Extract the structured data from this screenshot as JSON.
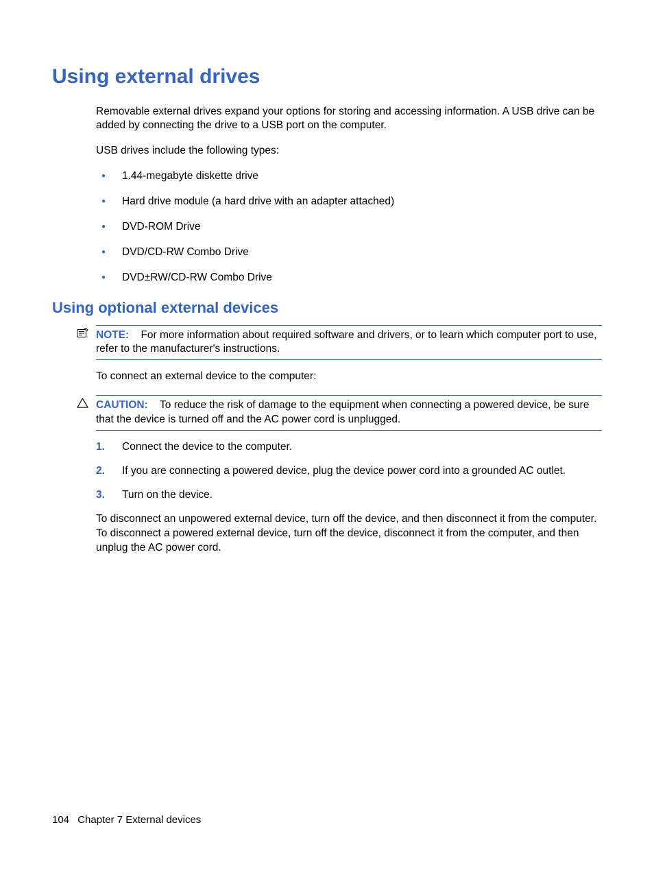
{
  "heading1": "Using external drives",
  "intro_p1": "Removable external drives expand your options for storing and accessing information. A USB drive can be added by connecting the drive to a USB port on the computer.",
  "intro_p2": "USB drives include the following types:",
  "bullets": [
    "1.44-megabyte diskette drive",
    "Hard drive module (a hard drive with an adapter attached)",
    "DVD-ROM Drive",
    "DVD/CD-RW Combo Drive",
    "DVD±RW/CD-RW Combo Drive"
  ],
  "heading2": "Using optional external devices",
  "note_label": "NOTE:",
  "note_text": "For more information about required software and drivers, or to learn which computer port to use, refer to the manufacturer's instructions.",
  "connect_intro": "To connect an external device to the computer:",
  "caution_label": "CAUTION:",
  "caution_text": "To reduce the risk of damage to the equipment when connecting a powered device, be sure that the device is turned off and the AC power cord is unplugged.",
  "steps": [
    "Connect the device to the computer.",
    "If you are connecting a powered device, plug the device power cord into a grounded AC outlet.",
    "Turn on the device."
  ],
  "disconnect_p": "To disconnect an unpowered external device, turn off the device, and then disconnect it from the computer. To disconnect a powered external device, turn off the device, disconnect it from the computer, and then unplug the AC power cord.",
  "footer_pagenum": "104",
  "footer_chapter": "Chapter 7   External devices"
}
